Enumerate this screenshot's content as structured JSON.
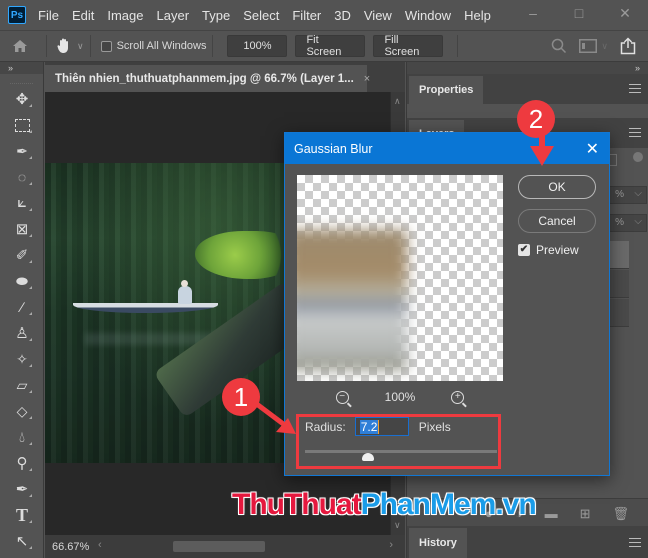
{
  "app": {
    "logo": "Ps",
    "menu": [
      "File",
      "Edit",
      "Image",
      "Layer",
      "Type",
      "Select",
      "Filter",
      "3D",
      "View",
      "Window",
      "Help"
    ],
    "window_controls": [
      "minimize",
      "maximize",
      "close"
    ]
  },
  "options_bar": {
    "scroll_all_windows_label": "Scroll All Windows",
    "scroll_all_windows_checked": false,
    "zoom_100_label": "100%",
    "fit_screen_label": "Fit Screen",
    "fill_screen_label": "Fill Screen"
  },
  "tools": [
    "move-tool",
    "marquee-tool",
    "lasso-tool",
    "quick-selection-tool",
    "crop-tool",
    "frame-tool",
    "eyedropper-tool",
    "healing-brush-tool",
    "brush-tool",
    "clone-stamp-tool",
    "history-brush-tool",
    "eraser-tool",
    "paint-bucket-tool",
    "blur-tool",
    "dodge-tool",
    "pen-tool",
    "type-tool",
    "path-selection-tool"
  ],
  "document": {
    "tab_title": "Thiên nhien_thuthuatphanmem.jpg @ 66.7% (Layer 1...",
    "close_glyph": "×",
    "zoom_status": "66.67%"
  },
  "panels": {
    "properties_label": "Properties",
    "layers_label": "Layers",
    "history_label": "History"
  },
  "dialog": {
    "title": "Gaussian Blur",
    "ok_label": "OK",
    "cancel_label": "Cancel",
    "preview_label": "Preview",
    "preview_checked": true,
    "preview_zoom": "100%",
    "radius_label": "Radius:",
    "radius_value": "7.2",
    "radius_unit": "Pixels",
    "radius_slider_fraction": 0.33
  },
  "annotations": {
    "step1": "1",
    "step2": "2",
    "highlight_color": "#ee3a3f"
  },
  "watermark": {
    "part1": "ThuThuat",
    "part2": "PhanMem.vn"
  },
  "colors": {
    "accent": "#0a76d5",
    "panel_bg": "#535353",
    "canvas_bg": "#282828"
  }
}
